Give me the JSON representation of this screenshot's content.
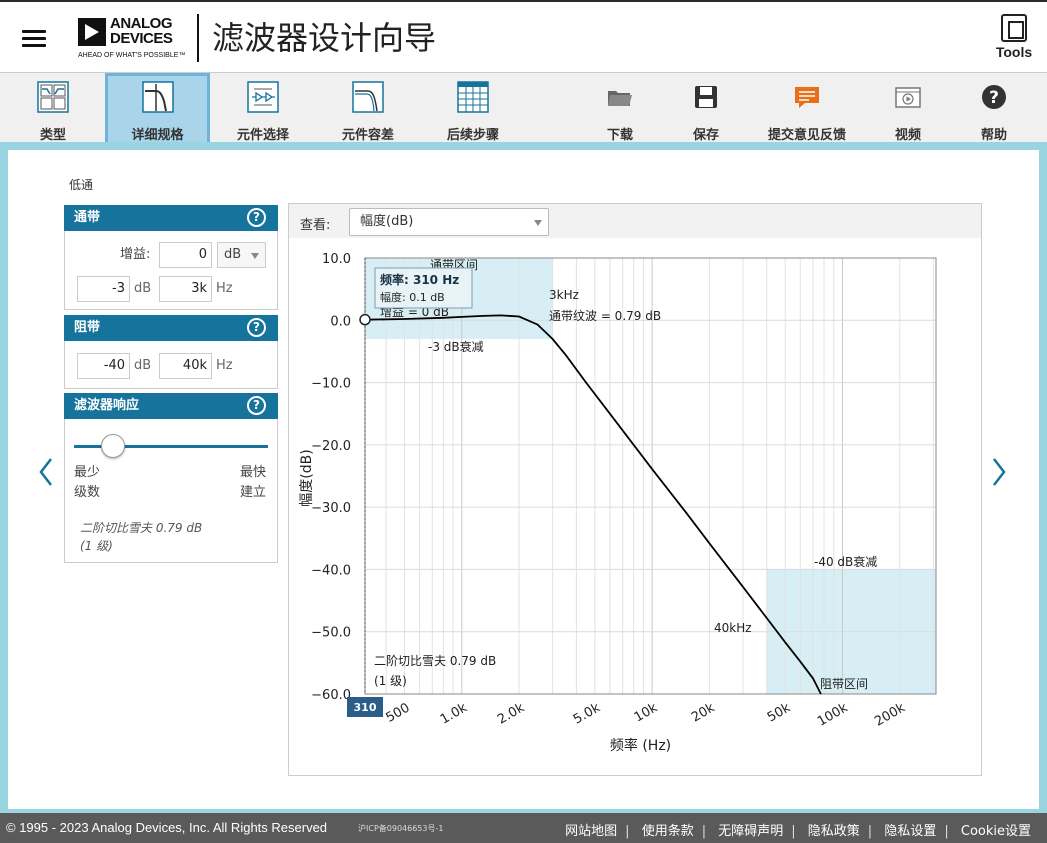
{
  "header": {
    "logo_line1": "ANALOG",
    "logo_line2": "DEVICES",
    "logo_tagline": "AHEAD OF WHAT'S POSSIBLE™",
    "title": "滤波器设计向导",
    "tools_label": "Tools"
  },
  "toolbar": {
    "items": [
      {
        "label": "类型",
        "icon": "filter-type-icon"
      },
      {
        "label": "详细规格",
        "icon": "specifications-icon",
        "active": true
      },
      {
        "label": "元件选择",
        "icon": "component-selection-icon"
      },
      {
        "label": "元件容差",
        "icon": "component-tolerance-icon"
      },
      {
        "label": "后续步骤",
        "icon": "next-steps-icon"
      },
      {
        "label": "下载",
        "icon": "folder-icon"
      },
      {
        "label": "保存",
        "icon": "save-icon"
      },
      {
        "label": "提交意见反馈",
        "icon": "feedback-icon"
      },
      {
        "label": "视频",
        "icon": "video-icon"
      },
      {
        "label": "帮助",
        "icon": "help-icon"
      }
    ]
  },
  "filter_type": "低通",
  "passband": {
    "title": "通带",
    "gain_label": "增益:",
    "gain_value": "0",
    "gain_unit": "dB",
    "atten_value": "-3",
    "atten_unit": "dB",
    "freq_value": "3k",
    "freq_unit": "Hz"
  },
  "stopband": {
    "title": "阻带",
    "atten_value": "-40",
    "atten_unit": "dB",
    "freq_value": "40k",
    "freq_unit": "Hz"
  },
  "response": {
    "title": "滤波器响应",
    "left_label_1": "最少",
    "left_label_2": "级数",
    "right_label_1": "最快",
    "right_label_2": "建立",
    "slider_fraction": 0.2,
    "note_1": "二阶切比雪夫 0.79 dB",
    "note_2": "(1 级)"
  },
  "chart_view": {
    "label": "查看:",
    "selected": "幅度(dB)"
  },
  "chart_data": {
    "type": "line",
    "xlabel": "频率 (Hz)",
    "ylabel": "幅度(dB)",
    "xscale": "log",
    "xlim": [
      310,
      310000
    ],
    "ylim": [
      -60,
      10
    ],
    "yticks": [
      "10.0",
      "0.0",
      "−10.0",
      "−20.0",
      "−30.0",
      "−40.0",
      "−50.0",
      "−60.0"
    ],
    "ytick_values": [
      10,
      0,
      -10,
      -20,
      -30,
      -40,
      -50,
      -60
    ],
    "xticks": [
      "500",
      "1.0k",
      "2.0k",
      "5.0k",
      "10k",
      "20k",
      "50k",
      "100k",
      "200k"
    ],
    "xtick_values": [
      500,
      1000,
      2000,
      5000,
      10000,
      20000,
      50000,
      100000,
      200000
    ],
    "cursor_label": "310",
    "series": [
      {
        "x": [
          310,
          500,
          800,
          1000,
          1300,
          1600,
          2000,
          2500,
          3000,
          3500,
          4500,
          6000,
          8000,
          10000,
          15000,
          20000,
          30000,
          40000,
          50000,
          60000,
          70000,
          77000
        ],
        "y": [
          0.1,
          0.2,
          0.4,
          0.55,
          0.7,
          0.79,
          0.6,
          -0.7,
          -3.0,
          -5.5,
          -10.0,
          -15.0,
          -20.0,
          -23.9,
          -30.8,
          -35.8,
          -42.8,
          -47.8,
          -51.7,
          -54.8,
          -57.5,
          -60.0
        ]
      }
    ],
    "passband_region_label": "通带区间",
    "passband_freq_label": "3kHz",
    "passband_ripple_label": "通带纹波 = 0.79 dB",
    "gain_label": "增益 = 0 dB",
    "atten_label": "-3 dB衰减",
    "stopband_atten_label": "-40 dB衰减",
    "stopband_freq_label": "40kHz",
    "stopband_region_label": "阻带区间",
    "filter_note_1": "二阶切比雪夫 0.79 dB",
    "filter_note_2": "(1 级)",
    "tooltip_freq": "频率: 310 Hz",
    "tooltip_mag": "幅度: 0.1 dB"
  },
  "footer": {
    "copyright": "© 1995 - 2023 Analog Devices, Inc. All Rights Reserved",
    "icp": "沪ICP备09046653号-1",
    "links": [
      "网站地图",
      "使用条款",
      "无障碍声明",
      "隐私政策",
      "隐私设置",
      "Cookie设置"
    ]
  }
}
